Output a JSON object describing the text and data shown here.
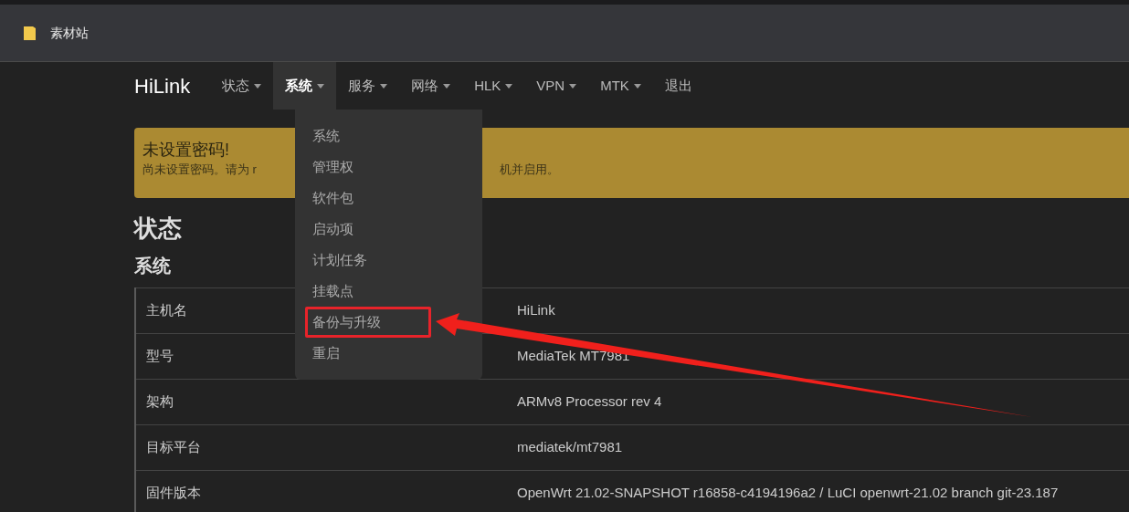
{
  "bookmarks_bar": {
    "items": [
      {
        "label": "素材站"
      }
    ]
  },
  "navbar": {
    "brand": "HiLink",
    "menus": [
      {
        "label": "状态",
        "caret": true,
        "selected": false
      },
      {
        "label": "系统",
        "caret": true,
        "selected": true
      },
      {
        "label": "服务",
        "caret": true,
        "selected": false
      },
      {
        "label": "网络",
        "caret": true,
        "selected": false
      },
      {
        "label": "HLK",
        "caret": true,
        "selected": false
      },
      {
        "label": "VPN",
        "caret": true,
        "selected": false
      },
      {
        "label": "MTK",
        "caret": true,
        "selected": false
      },
      {
        "label": "退出",
        "caret": false,
        "selected": false
      }
    ]
  },
  "dropdown": {
    "items": [
      {
        "label": "系统",
        "highlighted": false
      },
      {
        "label": "管理权",
        "highlighted": false
      },
      {
        "label": "软件包",
        "highlighted": false
      },
      {
        "label": "启动项",
        "highlighted": false
      },
      {
        "label": "计划任务",
        "highlighted": false
      },
      {
        "label": "挂载点",
        "highlighted": false
      },
      {
        "label": "备份与升级",
        "highlighted": true
      },
      {
        "label": "重启",
        "highlighted": false
      }
    ]
  },
  "alert": {
    "title": "未设置密码!",
    "message_start": "尚未设置密码。请为 r",
    "message_end": "机并启用。"
  },
  "page_title": "状态",
  "section_title": "系统",
  "table": {
    "rows": [
      {
        "label": "主机名",
        "value": "HiLink"
      },
      {
        "label": "型号",
        "value": "MediaTek MT7981"
      },
      {
        "label": "架构",
        "value": "ARMv8 Processor rev 4"
      },
      {
        "label": "目标平台",
        "value": "mediatek/mt7981"
      },
      {
        "label": "固件版本",
        "value": "OpenWrt 21.02-SNAPSHOT r16858-c4194196a2 / LuCI openwrt-21.02 branch git-23.187"
      }
    ]
  }
}
